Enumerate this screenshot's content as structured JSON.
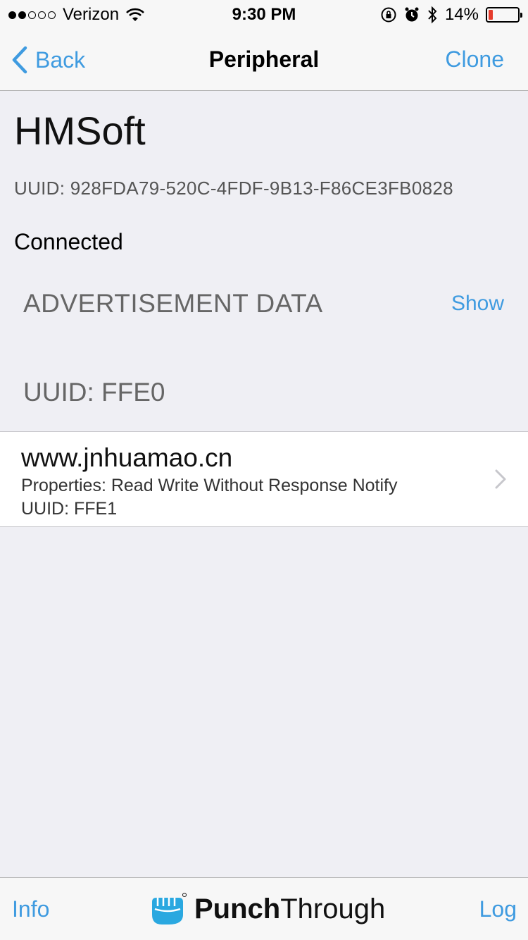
{
  "status_bar": {
    "carrier": "Verizon",
    "time": "9:30 PM",
    "battery_text": "14%",
    "battery_level": 0.14,
    "battery_color": "#e53b2c"
  },
  "nav": {
    "back_label": "Back",
    "title": "Peripheral",
    "right_label": "Clone"
  },
  "peripheral": {
    "name": "HMSoft",
    "uuid_text": "UUID: 928FDA79-520C-4FDF-9B13-F86CE3FB0828",
    "status": "Connected"
  },
  "advertisement": {
    "header": "ADVERTISEMENT DATA",
    "toggle_label": "Show"
  },
  "service": {
    "header": "UUID: FFE0"
  },
  "characteristics": [
    {
      "name": "www.jnhuamao.cn",
      "properties": "Properties: Read Write Without Response Notify",
      "uuid": "UUID: FFE1"
    }
  ],
  "tab_bar": {
    "left_label": "Info",
    "brand_bold": "Punch",
    "brand_regular": "Through",
    "right_label": "Log"
  },
  "colors": {
    "accent": "#3f9be0",
    "background": "#efeff4"
  }
}
